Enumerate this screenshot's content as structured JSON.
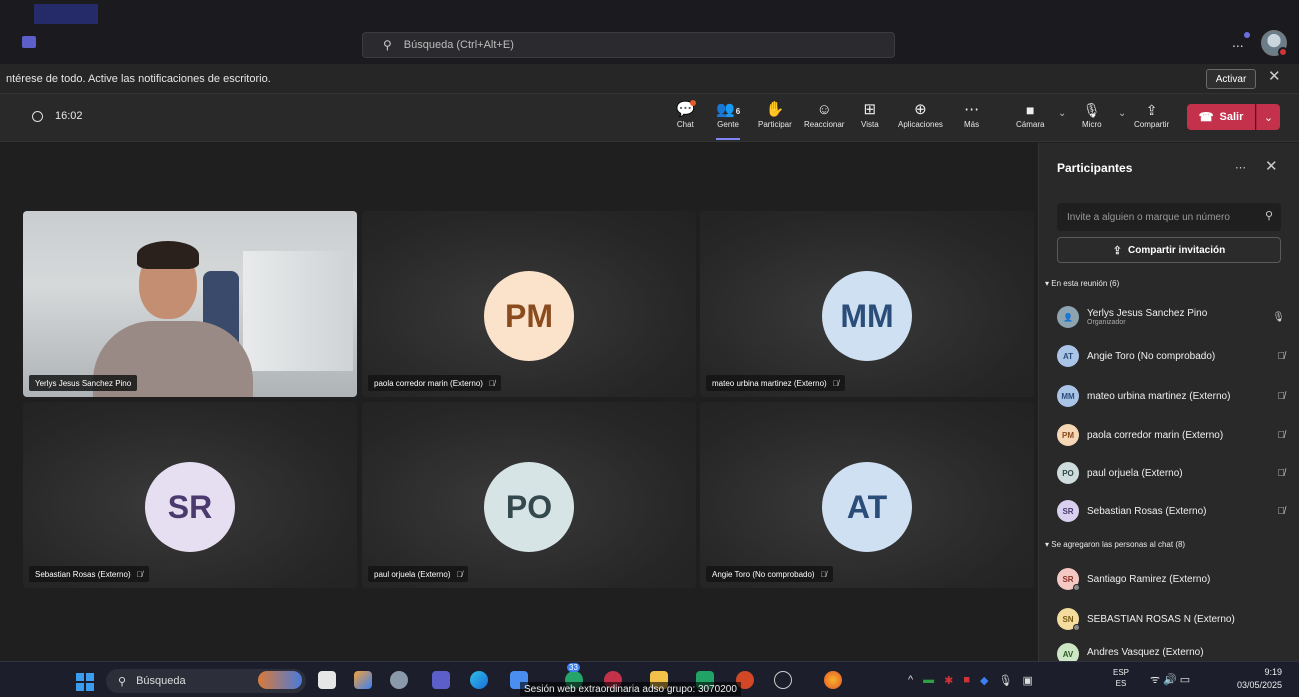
{
  "titlebar": {
    "search_placeholder": "Búsqueda (Ctrl+Alt+E)",
    "more_label": "..."
  },
  "notification": {
    "text": "ntérese de todo. Active las notificaciones de escritorio.",
    "activate_label": "Activar",
    "close_label": "✕"
  },
  "toolbar": {
    "timer": "16:02",
    "chat_label": "Chat",
    "people_label": "Gente",
    "people_count": "6",
    "raise_label": "Participar",
    "react_label": "Reaccionar",
    "view_label": "Vista",
    "apps_label": "Aplicaciones",
    "more_label": "Más",
    "camera_label": "Cámara",
    "mic_label": "Micro",
    "share_label": "Compartir",
    "leave_label": "Salir"
  },
  "tiles": [
    {
      "name": "Yerlys Jesus Sanchez Pino",
      "initials": "",
      "video": true
    },
    {
      "name": "paola corredor marin (Externo)",
      "initials": "PM",
      "color": "#fbe3cb",
      "text_color": "#8a4b1f"
    },
    {
      "name": "mateo urbina martinez (Externo)",
      "initials": "MM",
      "color": "#cfe0f2",
      "text_color": "#2b4d79"
    },
    {
      "name": "Sebastian Rosas (Externo)",
      "initials": "SR",
      "color": "#e6dff2",
      "text_color": "#4b3a6e"
    },
    {
      "name": "paul orjuela (Externo)",
      "initials": "PO",
      "color": "#d7e4e6",
      "text_color": "#34494d"
    },
    {
      "name": "Angie Toro (No comprobado)",
      "initials": "AT",
      "color": "#cfe0f2",
      "text_color": "#2b4d79"
    }
  ],
  "panel": {
    "title": "Participantes",
    "invite_placeholder": "Invite a alguien o marque un número",
    "share_invite_label": "Compartir invitación",
    "in_meeting_header": "▾ En esta reunión (6)",
    "in_meeting": [
      {
        "name": "Yerlys Jesus Sanchez Pino",
        "sub": "Organizador",
        "initials": "",
        "color": "#8ea3b0"
      },
      {
        "name": "Angie Toro (No comprobado)",
        "initials": "AT",
        "color": "#a9c4e6",
        "text_color": "#2b4d79"
      },
      {
        "name": "mateo urbina martinez (Externo)",
        "initials": "MM",
        "color": "#a9c4e6",
        "text_color": "#2b4d79"
      },
      {
        "name": "paola corredor marin (Externo)",
        "initials": "PM",
        "color": "#f6d7b6",
        "text_color": "#8a4b1f"
      },
      {
        "name": "paul orjuela (Externo)",
        "initials": "PO",
        "color": "#cfdcde",
        "text_color": "#34494d"
      },
      {
        "name": "Sebastian Rosas (Externo)",
        "initials": "SR",
        "color": "#d9cfee",
        "text_color": "#4b3a6e"
      }
    ],
    "added_header": "▾ Se agregaron las personas al chat (8)",
    "added": [
      {
        "name": "Santiago Ramirez (Externo)",
        "initials": "SR",
        "color": "#f4c9c4",
        "text_color": "#8a2f25"
      },
      {
        "name": "SEBASTIAN ROSAS N (Externo)",
        "initials": "SN",
        "color": "#f3dc9e",
        "text_color": "#7a5a12"
      },
      {
        "name": "Andres Vasquez (Externo)",
        "initials": "AV",
        "color": "#cde6c5",
        "text_color": "#2f5a24"
      }
    ]
  },
  "taskbar": {
    "search_label": "Búsqueda",
    "session_text": "Sesión web extraordinaria adso grupo: 3070200",
    "badge": "33",
    "lang_top": "ESP",
    "lang_bottom": "ES",
    "time": "9:19",
    "date": "03/05/2025"
  }
}
